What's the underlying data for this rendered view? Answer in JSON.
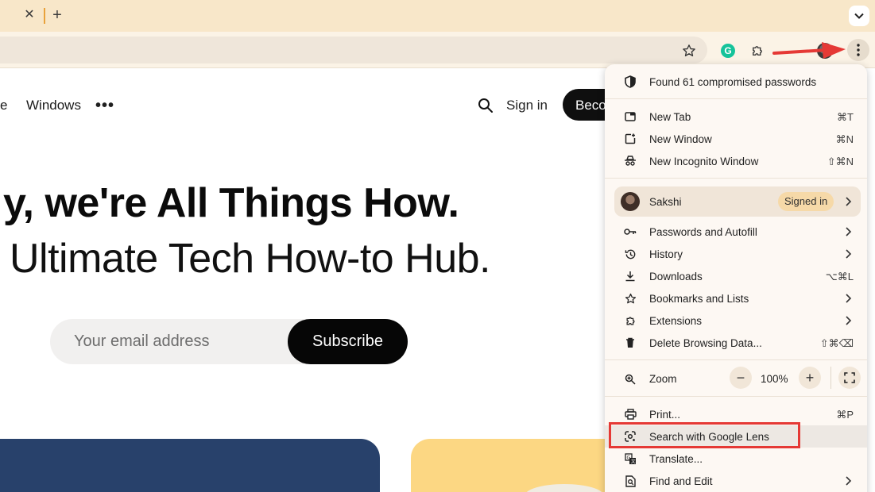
{
  "tabstrip": {
    "close_glyph": "✕",
    "new_tab_glyph": "+",
    "search_icon": "chevron-down-icon"
  },
  "toolbar": {
    "icons": [
      "star-icon",
      "grammarly-icon",
      "extensions-icon",
      "profile-icon",
      "chrome-menu-icon"
    ],
    "grammarly_letter": "G"
  },
  "page": {
    "nav_partial": "e",
    "nav_windows": "Windows",
    "nav_more": "•••",
    "sign_in": "Sign in",
    "become_button": "Become a member",
    "headline": "y, we're All Things How.",
    "subhead": "Ultimate Tech How-to Hub.",
    "email_placeholder": "Your email address",
    "subscribe": "Subscribe"
  },
  "menu": {
    "compromised": "Found 61 compromised passwords",
    "items_group1": [
      {
        "label": "New Tab",
        "shortcut": "⌘T",
        "icon": "new-tab-icon"
      },
      {
        "label": "New Window",
        "shortcut": "⌘N",
        "icon": "new-window-icon"
      },
      {
        "label": "New Incognito Window",
        "shortcut": "⇧⌘N",
        "icon": "incognito-icon"
      }
    ],
    "profile": {
      "name": "Sakshi",
      "badge": "Signed in"
    },
    "items_group2": [
      {
        "label": "Passwords and Autofill",
        "icon": "key-icon"
      },
      {
        "label": "History",
        "icon": "history-icon"
      },
      {
        "label": "Downloads",
        "shortcut": "⌥⌘L",
        "icon": "download-icon"
      },
      {
        "label": "Bookmarks and Lists",
        "icon": "star-outline-icon"
      },
      {
        "label": "Extensions",
        "icon": "puzzle-icon"
      },
      {
        "label": "Delete Browsing Data...",
        "shortcut": "⇧⌘⌫",
        "icon": "trash-icon"
      }
    ],
    "zoom": {
      "label": "Zoom",
      "minus": "−",
      "value": "100%",
      "plus": "+"
    },
    "items_group3": [
      {
        "label": "Print...",
        "shortcut": "⌘P",
        "icon": "print-icon"
      },
      {
        "label": "Search with Google Lens",
        "icon": "lens-icon"
      },
      {
        "label": "Translate...",
        "icon": "translate-icon"
      },
      {
        "label": "Find and Edit",
        "icon": "find-icon"
      }
    ]
  }
}
